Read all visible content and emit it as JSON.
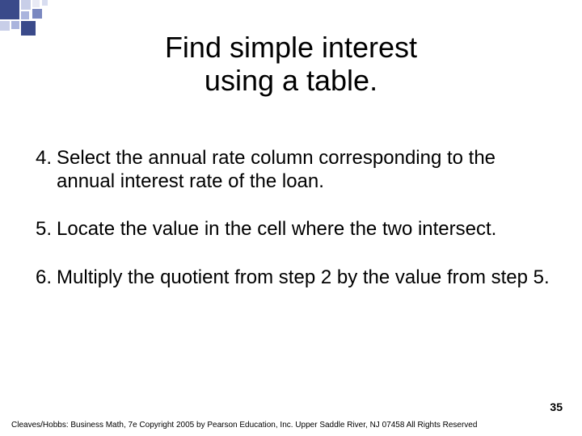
{
  "title_line1": "Find simple interest",
  "title_line2": "using a table.",
  "items": [
    {
      "num": "4.",
      "text": "Select the annual rate column corresponding to the annual interest rate of the loan."
    },
    {
      "num": "5.",
      "text": "Locate the value in the cell where the two intersect."
    },
    {
      "num": "6.",
      "text": " Multiply the quotient from step 2 by the value from step 5."
    }
  ],
  "page_number": "35",
  "footer": "Cleaves/Hobbs: Business Math, 7e  Copyright 2005 by Pearson Education, Inc. Upper Saddle River, NJ 07458  All Rights Reserved"
}
